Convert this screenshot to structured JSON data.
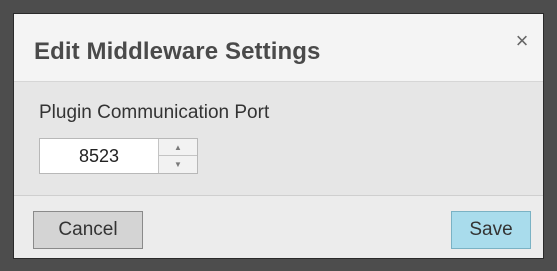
{
  "dialog": {
    "title": "Edit Middleware Settings",
    "close_glyph": "×",
    "close_icon": "close-icon"
  },
  "field": {
    "label": "Plugin Communication Port",
    "value": "8523",
    "up_glyph": "▲",
    "down_glyph": "▼"
  },
  "footer": {
    "cancel_label": "Cancel",
    "save_label": "Save"
  },
  "colors": {
    "backdrop": "#4d4d4d",
    "save_button": "#a9dcec",
    "cancel_button": "#d4d4d4"
  }
}
